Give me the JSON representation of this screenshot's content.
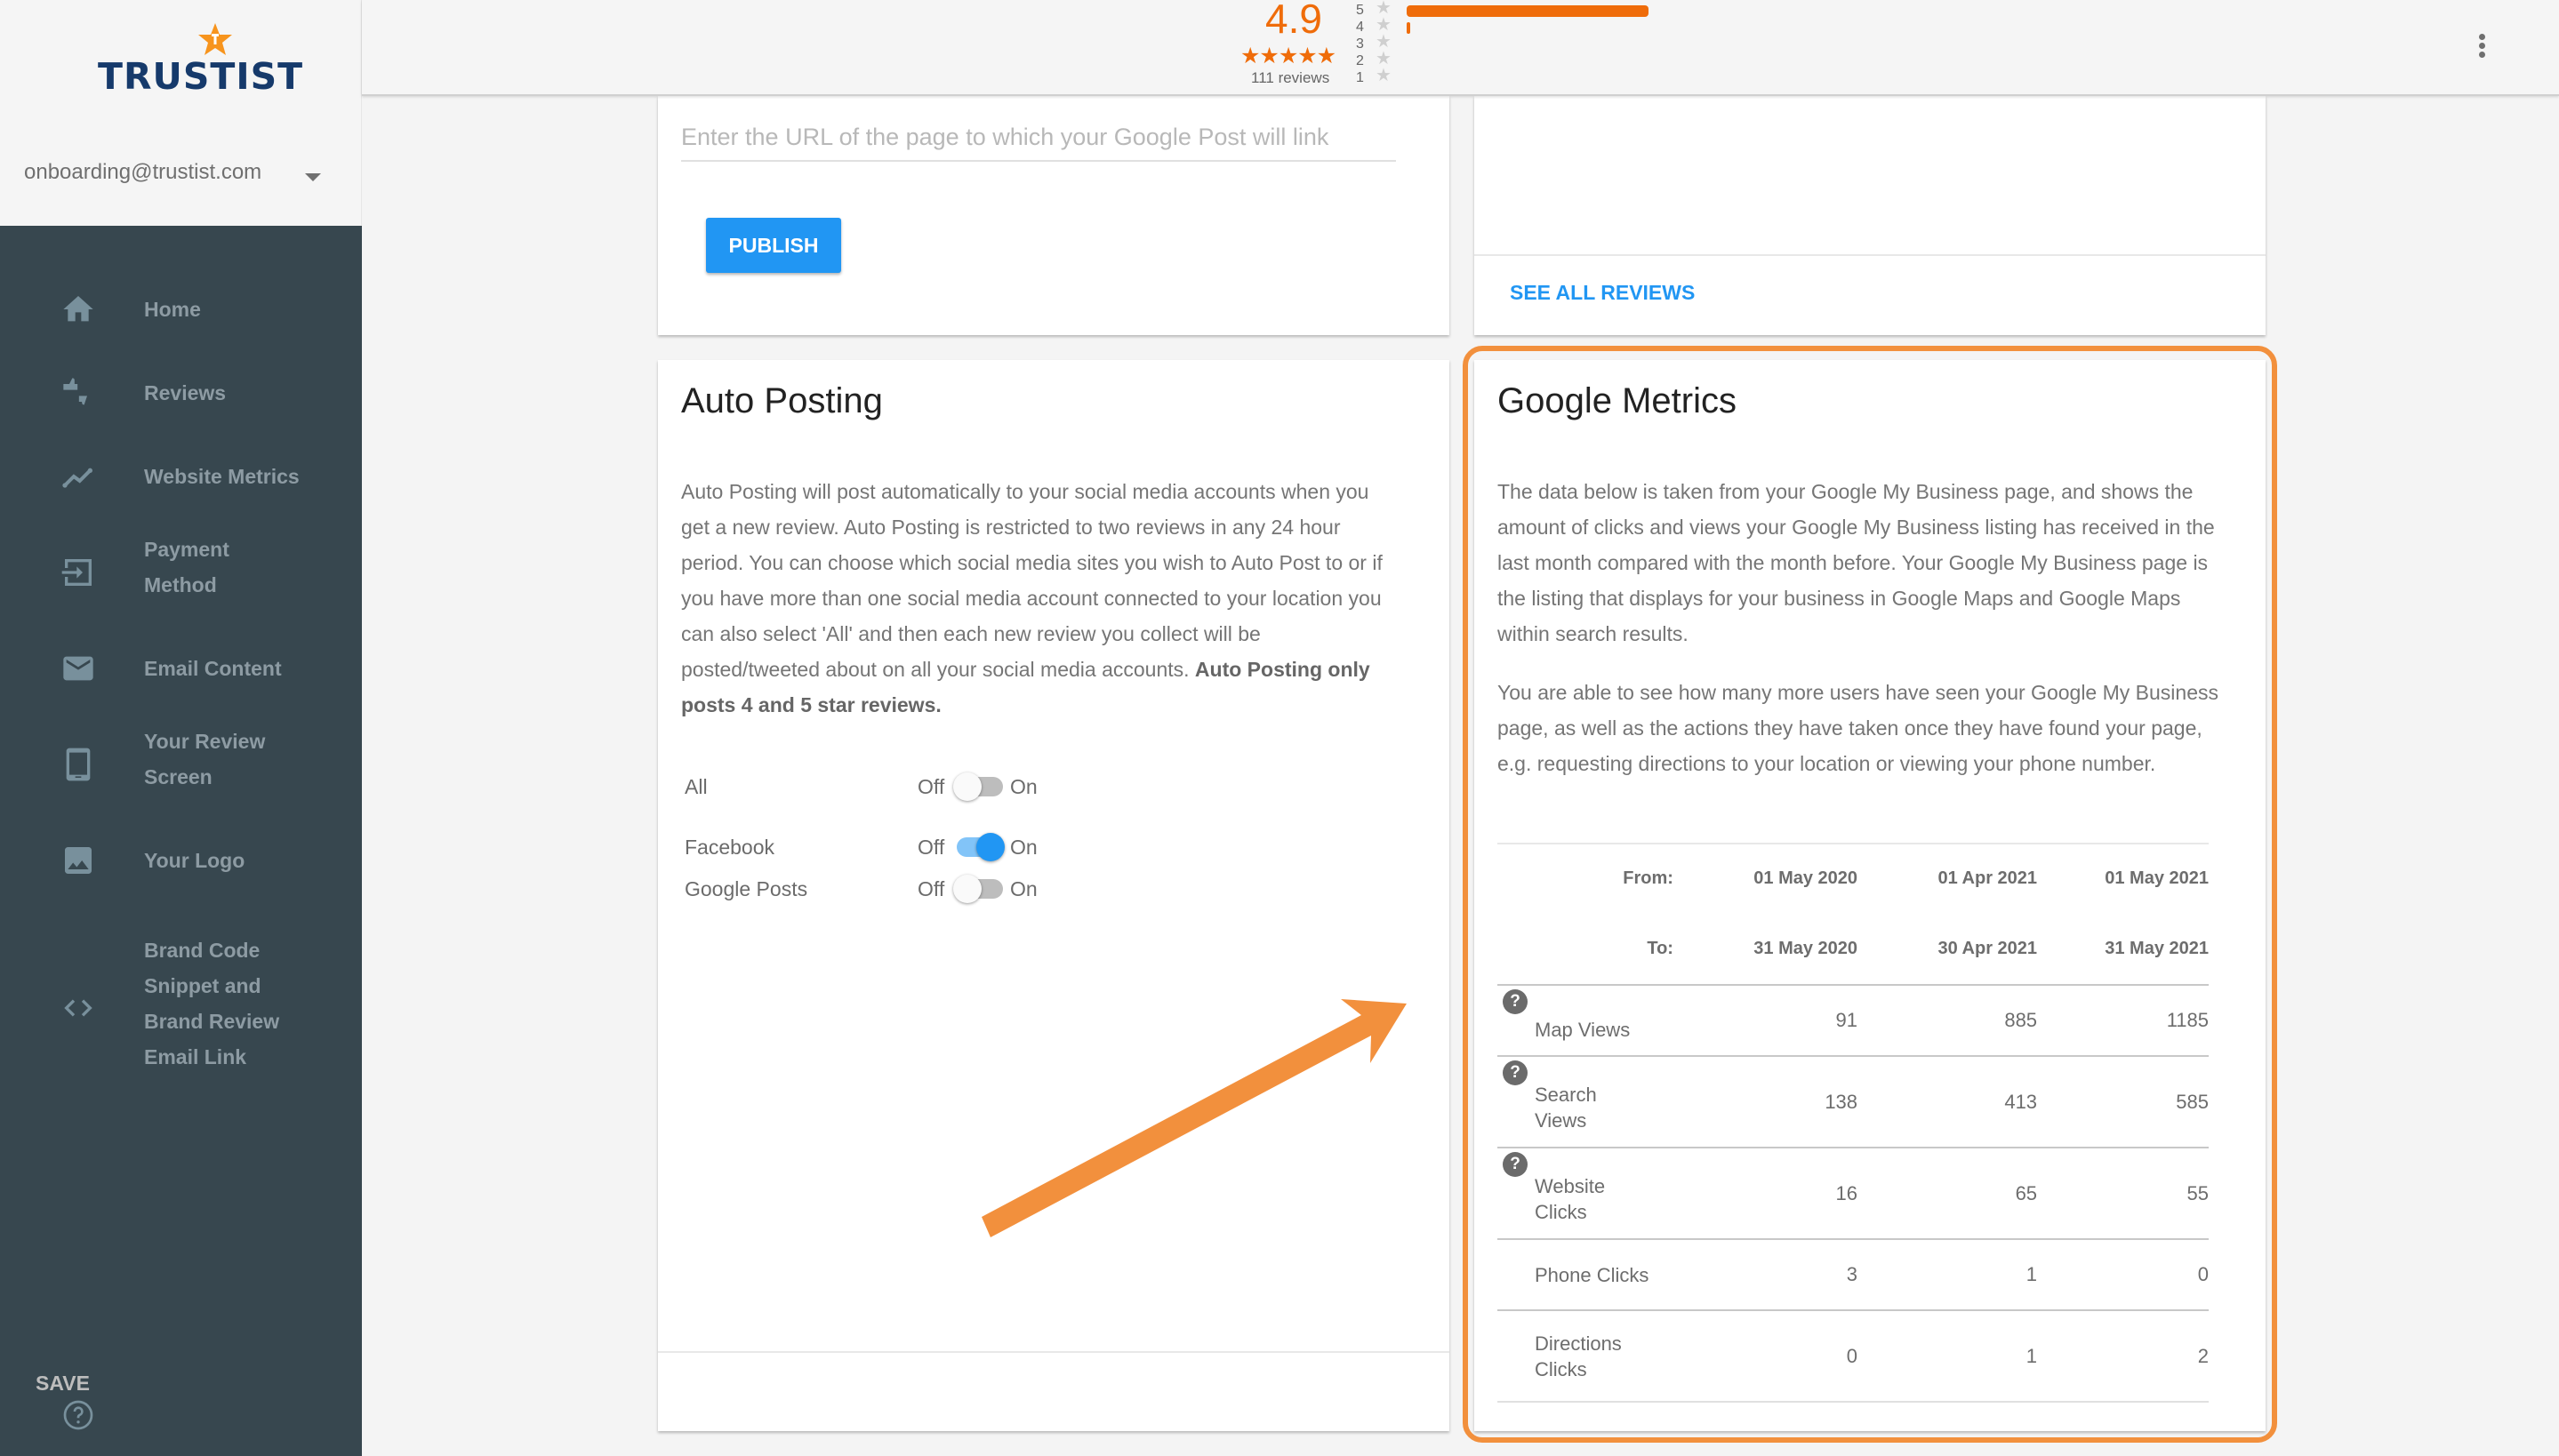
{
  "sidebar": {
    "logo_text": "TRUSTIST",
    "account_email": "onboarding@trustist.com",
    "items": [
      {
        "label": "Home",
        "icon": "home-icon"
      },
      {
        "label": "Reviews",
        "icon": "thumbs-up-down-icon"
      },
      {
        "label": "Website Metrics",
        "icon": "trending-line-icon"
      },
      {
        "label": "Payment\nMethod",
        "icon": "input-icon"
      },
      {
        "label": "Email Content",
        "icon": "mail-icon"
      },
      {
        "label": "Your Review\nScreen",
        "icon": "tablet-icon"
      },
      {
        "label": "Your Logo",
        "icon": "image-icon"
      },
      {
        "label": "Brand Code\nSnippet and\nBrand Review\nEmail Link",
        "icon": "code-icon"
      }
    ],
    "help_icon": "help-circle-icon"
  },
  "topbar": {
    "rating": "4.9",
    "stars": "★★★★★",
    "review_count": "111 reviews",
    "distribution": [
      {
        "stars": "5",
        "fraction": 0.96
      },
      {
        "stars": "4",
        "fraction": 0.04
      },
      {
        "stars": "3",
        "fraction": 0
      },
      {
        "stars": "2",
        "fraction": 0
      },
      {
        "stars": "1",
        "fraction": 0
      }
    ],
    "accent_color": "#ef6c0a"
  },
  "google_post_card": {
    "url_placeholder": "Enter the URL of the page to which your Google Post will link",
    "url_value": "",
    "publish_label": "PUBLISH"
  },
  "reviews_card": {
    "see_all_label": "SEE ALL REVIEWS"
  },
  "auto_posting": {
    "title": "Auto Posting",
    "description": "Auto Posting will post automatically to your social media accounts when you get a new review. Auto Posting is restricted to two reviews in any 24 hour period. You can choose which social media sites you wish to Auto Post to or if you have more than one social media account connected to your location you can also select 'All' and then each new review you collect will be posted/tweeted about on all your social media accounts.",
    "description_bold": "Auto Posting only posts 4 and 5 star reviews.",
    "off_label": "Off",
    "on_label": "On",
    "toggles": [
      {
        "label": "All",
        "on": false
      },
      {
        "label": "Facebook",
        "on": true
      },
      {
        "label": "Google Posts",
        "on": false
      }
    ],
    "save_label": "SAVE"
  },
  "google_metrics": {
    "title": "Google Metrics",
    "paragraph1": "The data below is taken from your Google My Business page, and shows the amount of clicks and views your Google My Business listing has received in the last month compared with the month before. Your Google My Business page is the listing that displays for your business in Google Maps and Google Maps within search results.",
    "paragraph2": "You are able to see how many more users have seen your Google My Business page, as well as the actions they have taken once they have found your page, e.g. requesting directions to your location or viewing your phone number.",
    "from_label": "From:",
    "to_label": "To:",
    "periods": [
      {
        "from": "01 May 2020",
        "to": "31 May 2020"
      },
      {
        "from": "01 Apr 2021",
        "to": "30 Apr 2021"
      },
      {
        "from": "01 May 2021",
        "to": "31 May 2021"
      }
    ],
    "rows": [
      {
        "label": "Map Views",
        "help": true,
        "values": [
          "91",
          "885",
          "1185"
        ]
      },
      {
        "label": "Search\nViews",
        "help": true,
        "values": [
          "138",
          "413",
          "585"
        ]
      },
      {
        "label": "Website\nClicks",
        "help": true,
        "values": [
          "16",
          "65",
          "55"
        ]
      },
      {
        "label": "Phone Clicks",
        "help": false,
        "values": [
          "3",
          "1",
          "0"
        ]
      },
      {
        "label": "Directions\nClicks",
        "help": false,
        "values": [
          "0",
          "1",
          "2"
        ]
      }
    ],
    "help_glyph": "?"
  },
  "annotation": {
    "highlight_color": "#f2903d"
  }
}
